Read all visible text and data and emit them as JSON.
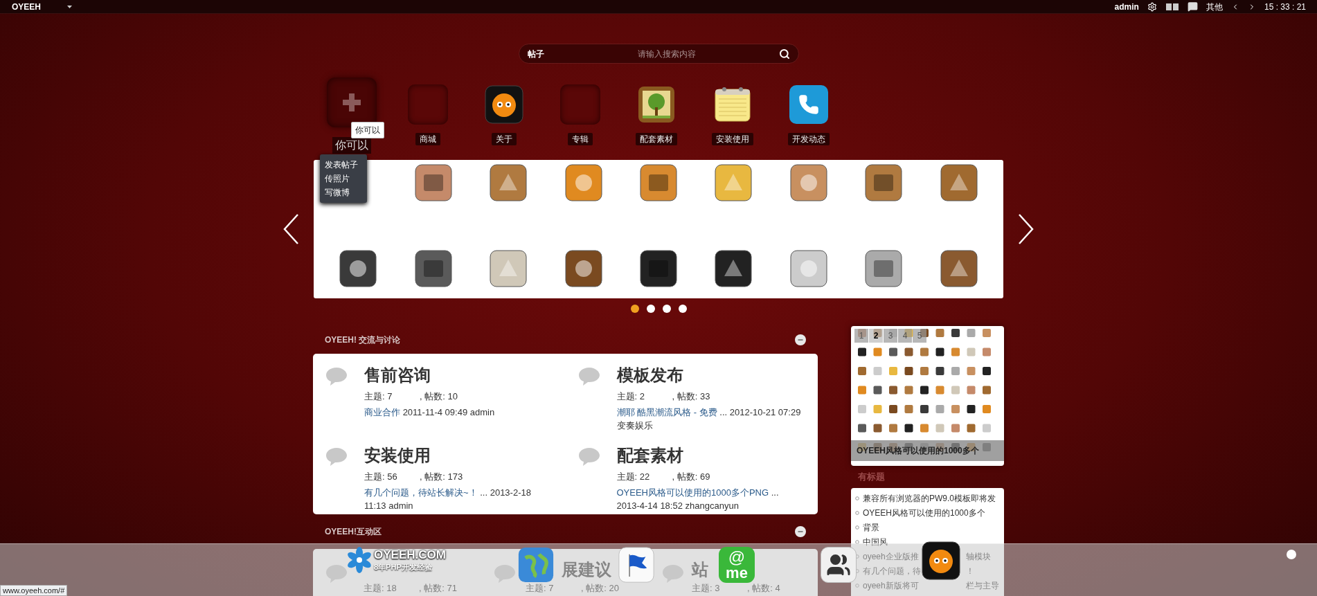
{
  "topbar": {
    "brand": "OYEEH",
    "user": "admin",
    "menu": "其他",
    "clock": "15 : 33 : 21"
  },
  "search": {
    "scope": "帖子",
    "placeholder": "请输入搜索内容"
  },
  "shortcuts": [
    {
      "label": "你可以",
      "kind": "add"
    },
    {
      "label": "商城",
      "kind": "empty"
    },
    {
      "label": "关于",
      "kind": "face"
    },
    {
      "label": "专辑",
      "kind": "empty"
    },
    {
      "label": "配套素材",
      "kind": "tree"
    },
    {
      "label": "安装使用",
      "kind": "notepad"
    },
    {
      "label": "开发动态",
      "kind": "phone"
    }
  ],
  "tooltip": "你可以",
  "add_menu": [
    "发表帖子",
    "传照片",
    "写微博"
  ],
  "carousel_pages": [
    {
      "selected": true
    },
    {
      "selected": false
    },
    {
      "selected": false
    },
    {
      "selected": false
    }
  ],
  "sections": [
    {
      "title": "OYEEH! 交流与讨论",
      "forums": [
        {
          "name": "售前咨询",
          "topics": "主题: 7",
          "posts": ", 帖数: 10",
          "last_link": "商业合作",
          "last_info": "2011-11-4 09:49 admin"
        },
        {
          "name": "模板发布",
          "topics": "主题: 2",
          "posts": ", 帖数: 33",
          "last_link": "潮耶 酷黑潮流风格 - 免费",
          "last_info": "... 2012-10-21 07:29 变奏娱乐"
        },
        {
          "name": "安装使用",
          "topics": "主题: 56",
          "posts": ", 帖数: 173",
          "last_link": "有几个问题，待站长解决~！",
          "last_info": "... 2013-2-18 11:13 admin"
        },
        {
          "name": "配套素材",
          "topics": "主题: 22",
          "posts": ", 帖数: 69",
          "last_link": "OYEEH风格可以使用的1000多个PNG",
          "last_info": "... 2013-4-14 18:52 zhangcanyun"
        }
      ]
    },
    {
      "title": "OYEEH!互动区",
      "forums": [
        {
          "topics": "主题: 18",
          "posts": ", 帖数: 71"
        },
        {
          "name": "展建议",
          "topics": "主题: 7",
          "posts": ", 帖数: 20"
        },
        {
          "name": "站",
          "topics": "主题: 3",
          "posts": ", 帖数: 4"
        }
      ]
    }
  ],
  "gallery": {
    "pages": [
      {
        "label": "1",
        "selected": false
      },
      {
        "label": "2",
        "selected": true
      },
      {
        "label": "3",
        "selected": false
      },
      {
        "label": "4",
        "selected": false
      },
      {
        "label": "5",
        "selected": false
      }
    ],
    "caption": "OYEEH风格可以使用的1000多个"
  },
  "sidebar_heading": "有标题",
  "sidebar_list": [
    {
      "text": "兼容所有浏览器的PW9.0模板即将发"
    },
    {
      "text": "OYEEH风格可以使用的1000多个"
    },
    {
      "text": "背景"
    },
    {
      "text": "中国风"
    },
    {
      "text": "oyeeh企业版推",
      "tail": "轴模块"
    },
    {
      "text": "有几个问题，待",
      "tail": "！"
    },
    {
      "text": "oyeeh新版将可",
      "tail": "栏与主导"
    }
  ],
  "dock": {
    "logo": "OYEEH.COM",
    "slogan": "8年PHP开发经验",
    "at_mark": "@",
    "me_mark": "me"
  },
  "status": "www.oyeeh.com/#"
}
